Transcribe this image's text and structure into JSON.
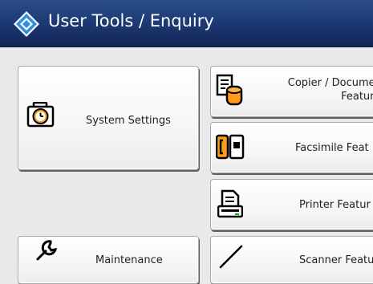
{
  "header": {
    "title": "User Tools / Enquiry",
    "logo_icon": "user-tools-diamond-icon"
  },
  "buttons": {
    "system_settings": {
      "label": "System Settings",
      "icon": "toolbox-clock-icon"
    },
    "copier": {
      "label_line1": "Copier / Document",
      "label_line2": "Features",
      "icon": "documents-server-icon"
    },
    "facsimile": {
      "label": "Facsimile Feat",
      "icon": "fax-icon"
    },
    "printer": {
      "label": "Printer Featur",
      "icon": "printer-icon"
    },
    "maintenance": {
      "label": "Maintenance",
      "icon": "wrench-icon"
    },
    "scanner": {
      "label": "Scanner Featu",
      "icon": "scanner-pen-icon"
    }
  },
  "colors": {
    "header": "#1c3770",
    "panel": "#e9e9e9",
    "button_face": "#ffffff"
  }
}
